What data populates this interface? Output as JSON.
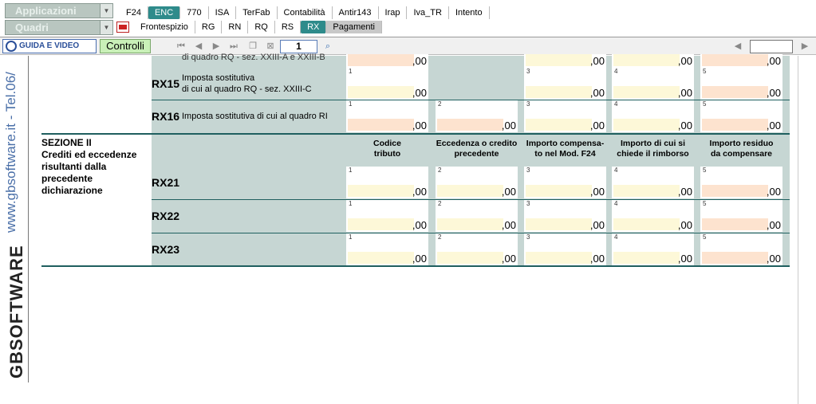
{
  "top": {
    "combo1": "Applicazioni",
    "combo2": "Quadri",
    "tabs_row1": [
      "F24",
      "ENC",
      "770",
      "ISA",
      "TerFab",
      "Contabilità",
      "Antir143",
      "Irap",
      "Iva_TR",
      "Intento"
    ],
    "tabs_row1_active": "ENC",
    "tabs_row2": [
      "Frontespizio",
      "RG",
      "RN",
      "RQ",
      "RS",
      "RX",
      "Pagamenti"
    ],
    "tabs_row2_active": "RX"
  },
  "toolbar": {
    "guide_label": "GUIDA E VIDEO",
    "controls_label": "Controlli",
    "page_value": "1"
  },
  "sidebar": {
    "website": "www.gbsoftware.it - Tel.06/",
    "brand": "GBSOFTWARE"
  },
  "form": {
    "cut_text": "di quadro RQ - sez. XXIII-A e XXIII-B",
    "rx15": {
      "code": "RX15",
      "desc1": "Imposta sostitutiva",
      "desc2": "di cui al quadro RQ - sez. XXIII-C"
    },
    "rx16": {
      "code": "RX16",
      "desc": "Imposta sostitutiva di cui al quadro RI"
    },
    "section": {
      "title": "SEZIONE II",
      "sub": [
        "Crediti ed eccedenze",
        "risultanti dalla",
        "precedente",
        "dichiarazione"
      ]
    },
    "col_headers": [
      [
        "Codice",
        "tributo"
      ],
      [
        "Eccedenza o credito",
        "precedente"
      ],
      [
        "Importo compensa-",
        "to nel Mod. F24"
      ],
      [
        "Importo di cui si",
        "chiede il rimborso"
      ],
      [
        "Importo residuo",
        "da compensare"
      ]
    ],
    "rows2": [
      "RX21",
      "RX22",
      "RX23"
    ],
    "zero": ",00",
    "field_numbers": [
      "1",
      "2",
      "3",
      "4",
      "5"
    ]
  }
}
